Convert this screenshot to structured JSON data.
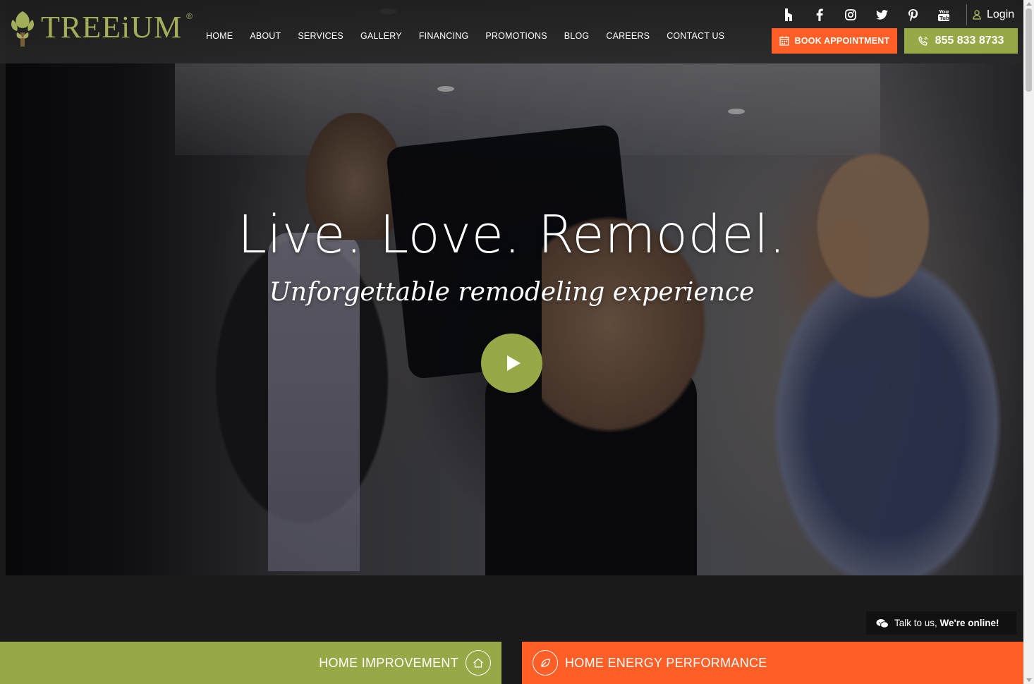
{
  "brand": {
    "name": "TREEiUM",
    "reg_mark": "®"
  },
  "nav": {
    "items": [
      "HOME",
      "ABOUT",
      "SERVICES",
      "GALLERY",
      "FINANCING",
      "PROMOTIONS",
      "BLOG",
      "CAREERS",
      "CONTACT US"
    ]
  },
  "social": {
    "icons": [
      "houzz-icon",
      "facebook-icon",
      "instagram-icon",
      "twitter-icon",
      "pinterest-icon",
      "youtube-icon"
    ],
    "glyphs": [
      "ℏ",
      "f",
      "◎",
      "🐦",
      "P",
      "▶"
    ]
  },
  "header": {
    "login_label": "Login",
    "book_label": "BOOK APPOINTMENT",
    "phone_label": "855 833 8733"
  },
  "hero": {
    "headline": "Live. Love. Remodel.",
    "subhead": "Unforgettable remodeling experience"
  },
  "chat": {
    "prefix": "Talk to us, ",
    "status": "We're online!"
  },
  "panels": {
    "left_label": "HOME IMPROVEMENT",
    "right_label": "HOME ENERGY PERFORMANCE"
  },
  "colors": {
    "accent_green": "#97a847",
    "accent_orange": "#ff5f26",
    "logo_green": "#a3ad5a"
  }
}
